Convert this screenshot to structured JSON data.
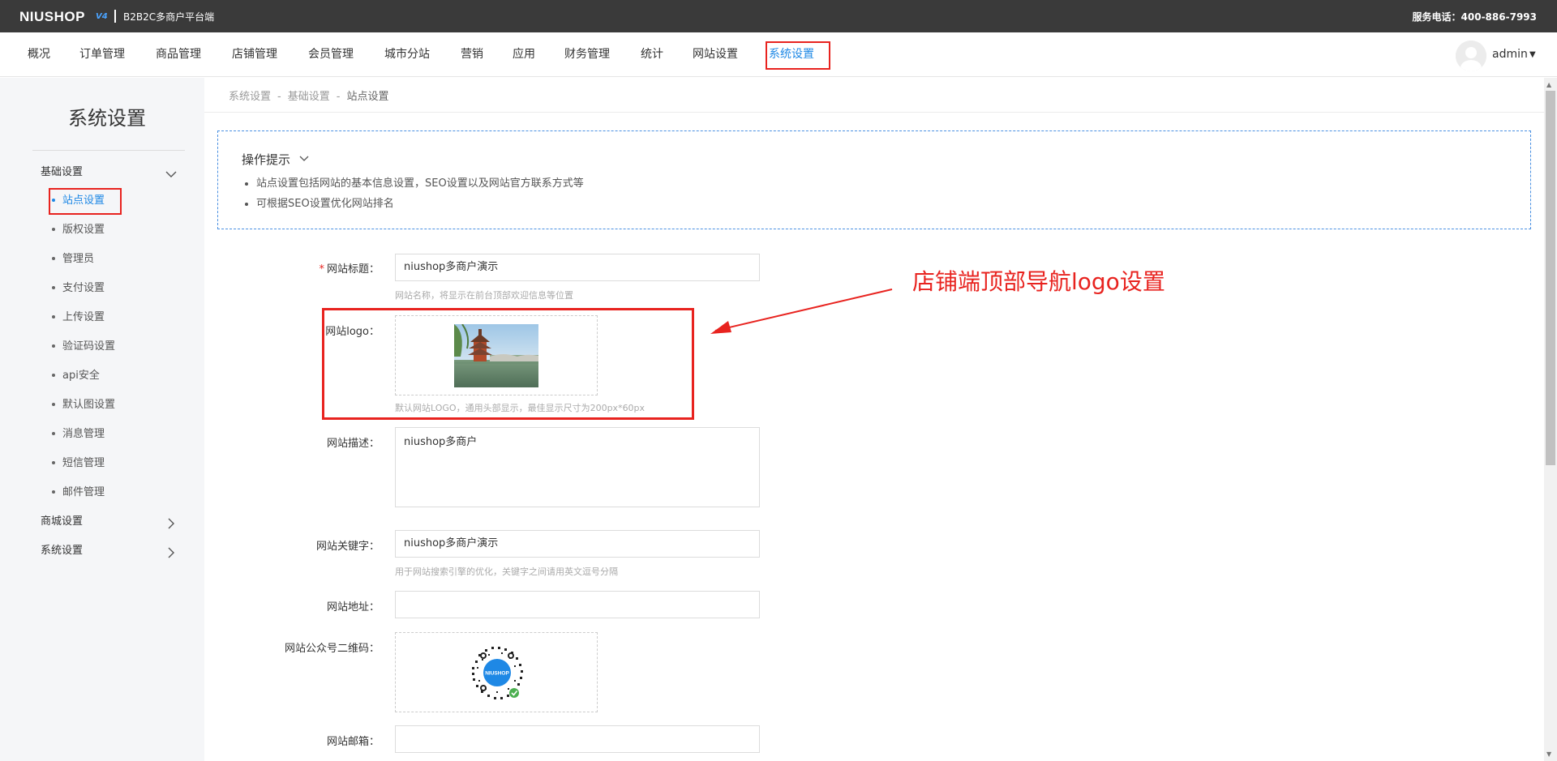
{
  "topbar": {
    "brand": "NIUSHOP",
    "brand_version": "V4",
    "subtitle": "B2B2C多商户平台端",
    "hotline": "服务电话：400-886-7993"
  },
  "nav": {
    "items": [
      "概况",
      "订单管理",
      "商品管理",
      "店铺管理",
      "会员管理",
      "城市分站",
      "营销",
      "应用",
      "财务管理",
      "统计",
      "网站设置",
      "系统设置"
    ],
    "active": "系统设置",
    "user": "admin"
  },
  "sidebar": {
    "title": "系统设置",
    "group1": "基础设置",
    "subitems": [
      "站点设置",
      "版权设置",
      "管理员",
      "支付设置",
      "上传设置",
      "验证码设置",
      "api安全",
      "默认图设置",
      "消息管理",
      "短信管理",
      "邮件管理"
    ],
    "group2": "商城设置",
    "group3": "系统设置"
  },
  "breadcrumb": [
    "系统设置",
    "基础设置",
    "站点设置"
  ],
  "breadcrumb_sep": "-",
  "tips": {
    "title": "操作提示",
    "items": [
      "站点设置包括网站的基本信息设置，SEO设置以及网站官方联系方式等",
      "可根据SEO设置优化网站排名"
    ]
  },
  "form": {
    "title_label": "网站标题：",
    "required_mark": "*",
    "title_value": "niushop多商户演示",
    "title_hint": "网站名称，将显示在前台顶部欢迎信息等位置",
    "logo_label": "网站logo：",
    "logo_hint": "默认网站LOGO，通用头部显示，最佳显示尺寸为200px*60px",
    "desc_label": "网站描述：",
    "desc_value": "niushop多商户",
    "keywords_label": "网站关键字：",
    "keywords_value": "niushop多商户演示",
    "keywords_hint": "用于网站搜索引擎的优化，关键字之间请用英文逗号分隔",
    "url_label": "网站地址：",
    "url_value": "",
    "qrcode_label": "网站公众号二维码：",
    "qrcode_logo_text": "NIUSHOP",
    "email_label": "网站邮箱：",
    "email_value": ""
  },
  "annotation": "店铺端顶部导航logo设置",
  "colors": {
    "accent": "#1e88e5",
    "highlight": "#e8231f",
    "topbar": "#3a3a3a"
  }
}
